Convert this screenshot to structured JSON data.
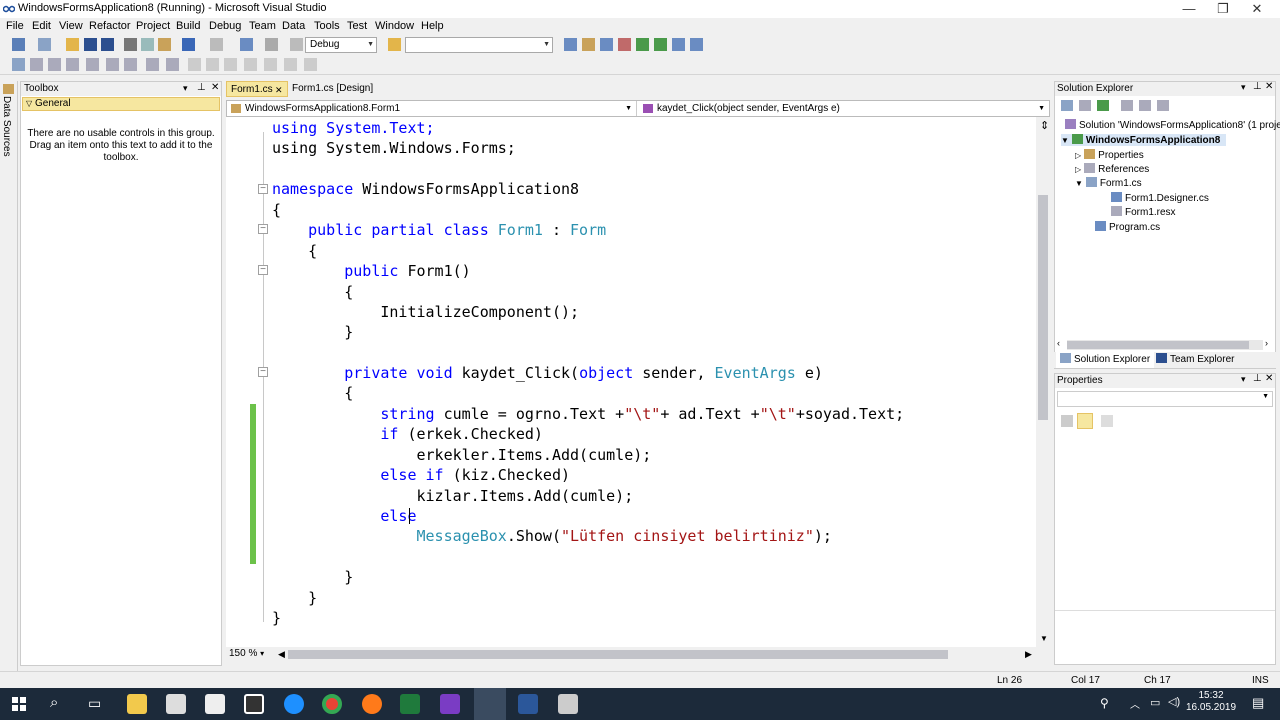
{
  "window": {
    "title": "WindowsFormsApplication8 (Running) - Microsoft Visual Studio",
    "min_label": "—",
    "restore_label": "❐",
    "close_label": "✕"
  },
  "menu": [
    "File",
    "Edit",
    "View",
    "Refactor",
    "Project",
    "Build",
    "Debug",
    "Team",
    "Data",
    "Tools",
    "Test",
    "Window",
    "Help"
  ],
  "toolbar": {
    "config": "Debug",
    "search": ""
  },
  "left_strip": {
    "label": "Data Sources"
  },
  "toolbox": {
    "title": "Toolbox",
    "group": "General",
    "empty_message": "There are no usable controls in this group. Drag an item onto this text to add it to the toolbox."
  },
  "tabs": [
    {
      "label": "Form1.cs",
      "close": "✕"
    },
    {
      "label": "Form1.cs [Design]"
    }
  ],
  "nav": {
    "class_combo": "WindowsFormsApplication8.Form1",
    "member_combo": "kaydet_Click(object sender, EventArgs e)"
  },
  "code": {
    "l1": "using System.Text;",
    "l2": "using System.Windows.Forms;",
    "l3a": "namespace",
    "l3b": " WindowsFormsApplication8",
    "l4": "{",
    "l5a": "    public partial class",
    "l5b": " Form1",
    "l5c": " : ",
    "l5d": "Form",
    "l6": "    {",
    "l7a": "        public",
    "l7b": " Form1()",
    "l8": "        {",
    "l9": "            InitializeComponent();",
    "l10": "        }",
    "l11a": "        private void",
    "l11b": " kaydet_Click(",
    "l11c": "object",
    "l11d": " sender, ",
    "l11e": "EventArgs",
    "l11f": " e)",
    "l12": "        {",
    "l13a": "            string",
    "l13b": " cumle = ogrno.Text +",
    "l13c": "\"\\t\"",
    "l13d": "+ ad.Text +",
    "l13e": "\"\\t\"",
    "l13f": "+soyad.Text;",
    "l14a": "            if",
    "l14b": " (erkek.Checked)",
    "l15": "                erkekler.Items.Add(cumle);",
    "l16a": "            else if",
    "l16b": " (kiz.Checked)",
    "l17": "                kizlar.Items.Add(cumle);",
    "l18": "            else",
    "l19a": "                MessageBox",
    "l19b": ".Show(",
    "l19c": "\"Lütfen cinsiyet belirtiniz\"",
    "l19d": ");",
    "l20": "        }",
    "l21": "    }",
    "l22": "}"
  },
  "editor_footer": {
    "zoom": "150 %"
  },
  "solution_explorer": {
    "title": "Solution Explorer",
    "items": [
      "Solution 'WindowsFormsApplication8' (1 proje",
      "WindowsFormsApplication8",
      "Properties",
      "References",
      "Form1.cs",
      "Form1.Designer.cs",
      "Form1.resx",
      "Program.cs"
    ],
    "tab1": "Solution Explorer",
    "tab2": "Team Explorer"
  },
  "properties": {
    "title": "Properties"
  },
  "status": {
    "ln": "Ln 26",
    "col": "Col 17",
    "ch": "Ch 17",
    "mode": "INS"
  },
  "clock": {
    "time": "15:32",
    "date": "16.05.2019"
  },
  "colors": {
    "keyword": "#0000ff",
    "type": "#2b91af",
    "string": "#a31515",
    "taskbar": "#1c2a3a",
    "accent": "#f6e7a0"
  }
}
